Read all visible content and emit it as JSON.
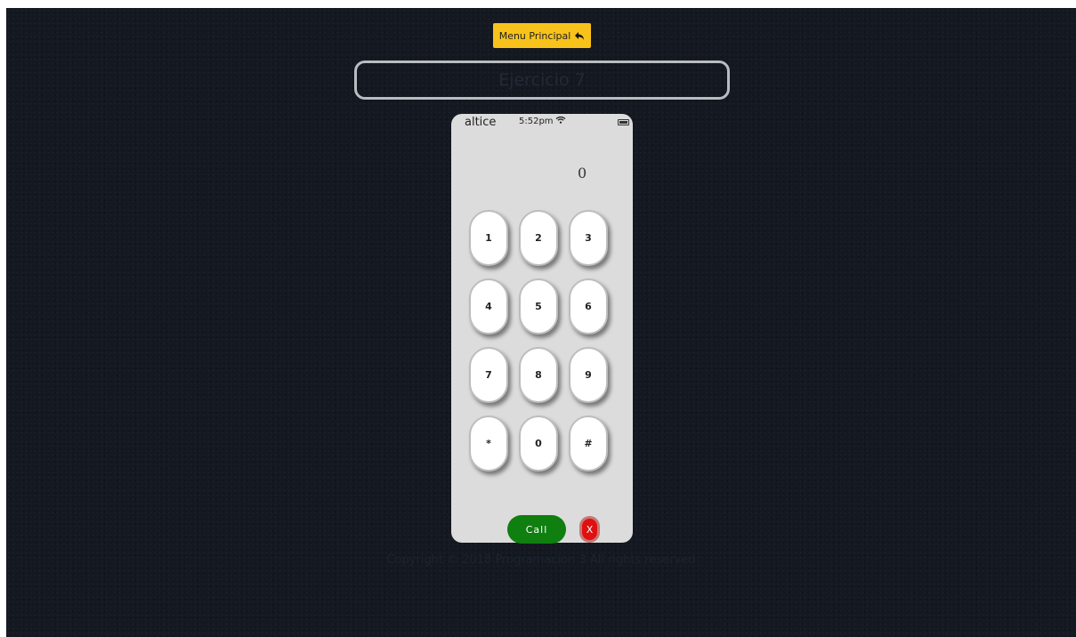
{
  "header": {
    "menu_label": "Menu Principal",
    "title": "Ejercicio 7"
  },
  "phone": {
    "carrier": "altice",
    "time": "5:52pm",
    "display_value": "0",
    "keys": [
      "1",
      "2",
      "3",
      "4",
      "5",
      "6",
      "7",
      "8",
      "9",
      "*",
      "0",
      "#"
    ],
    "call_label": "Call",
    "delete_label": "X"
  },
  "footer": {
    "copyright": "Copyright © 2018 Programacion 3 All rights reserved"
  },
  "icons": {
    "menu": "reply-arrow-icon",
    "wifi": "wifi-icon",
    "battery": "battery-icon"
  },
  "colors": {
    "background": "#141820",
    "menu_button": "#f7c21a",
    "phone_body": "#dcdcdc",
    "call": "#0f7f0f",
    "delete": "#e01010"
  }
}
